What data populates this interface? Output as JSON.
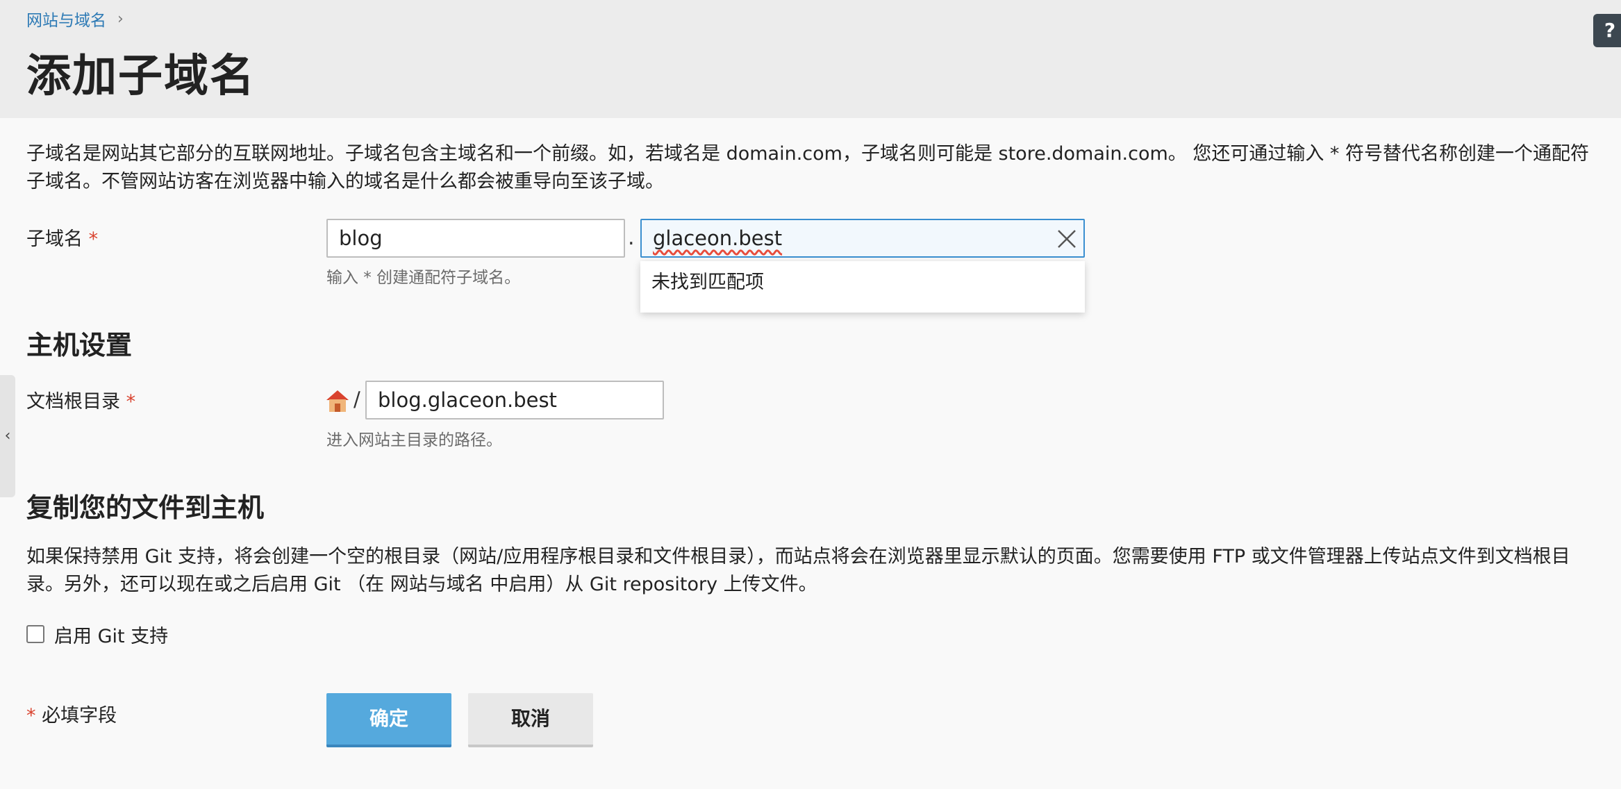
{
  "header": {
    "breadcrumb": "网站与域名",
    "breadcrumb_separator": "›",
    "title": "添加子域名",
    "help_label": "?"
  },
  "side_tab": {
    "label": "‹"
  },
  "subdomain": {
    "description": "子域名是网站其它部分的互联网地址。子域名包含主域名和一个前缀。如，若域名是 domain.com，子域名则可能是 store.domain.com。 您还可通过输入 * 符号替代名称创建一个通配符子域名。不管网站访客在浏览器中输入的域名是什么都会被重导向至该子域。",
    "label": "子域名",
    "required_mark": "*",
    "prefix_value": "blog",
    "separator": ".",
    "domain_value": "glaceon.best",
    "hint": "输入 * 创建通配符子域名。",
    "dropdown_message": "未找到匹配项"
  },
  "hosting": {
    "section_title": "主机设置",
    "docroot_label": "文档根目录",
    "required_mark": "*",
    "slash": "/",
    "docroot_value": "blog.glaceon.best",
    "hint": "进入网站主目录的路径。"
  },
  "copy_files": {
    "section_title": "复制您的文件到主机",
    "description": "如果保持禁用 Git 支持，将会创建一个空的根目录（网站/应用程序根目录和文件根目录），而站点将会在浏览器里显示默认的页面。您需要使用 FTP 或文件管理器上传站点文件到文档根目录。另外，还可以现在或之后启用 Git （在 网站与域名 中启用）从 Git repository 上传文件。",
    "git_checkbox_label": "启用 Git 支持",
    "git_enabled": false
  },
  "footer": {
    "required_mark": "*",
    "required_note": "必填字段",
    "ok_label": "确定",
    "cancel_label": "取消"
  },
  "colors": {
    "link": "#2d7ab5",
    "required": "#d9432f",
    "primary_button": "#55a9dd",
    "header_bg": "#ececec"
  }
}
